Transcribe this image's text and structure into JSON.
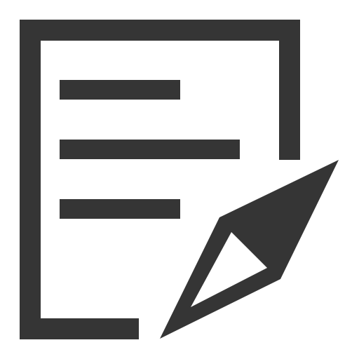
{
  "icon": {
    "name": "document-edit-icon",
    "parts": [
      "document-outline",
      "text-lines",
      "pen-nib"
    ],
    "foreground_color": "#353535",
    "background_color": "#ffffff"
  }
}
